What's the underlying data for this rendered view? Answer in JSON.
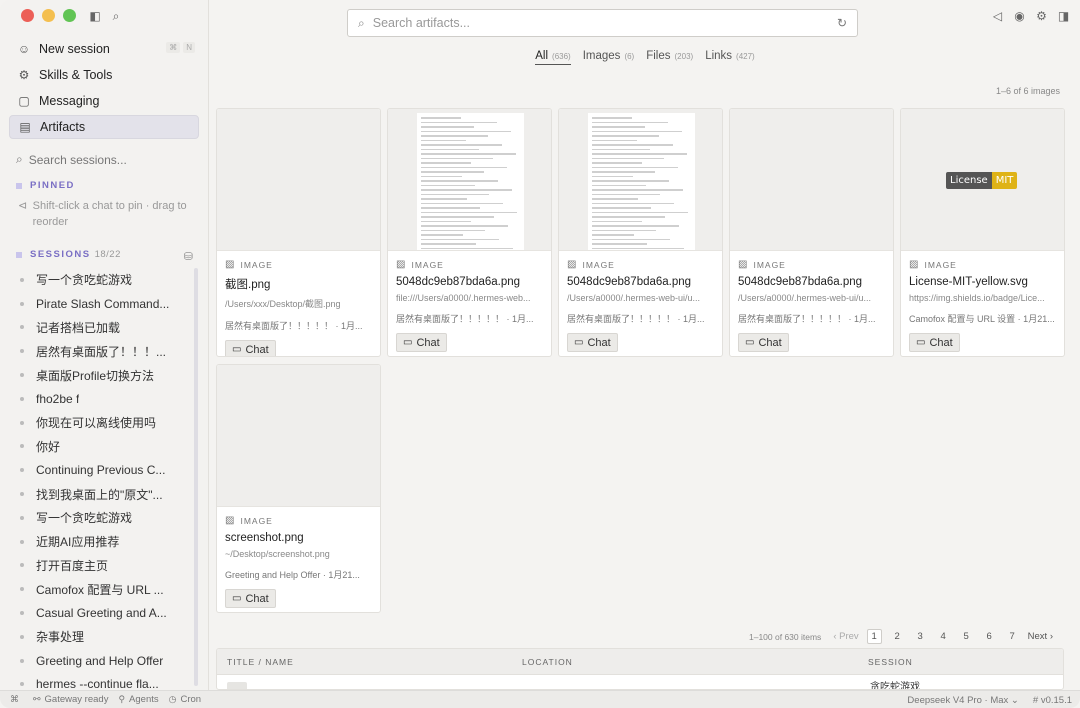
{
  "sidebar": {
    "nav": [
      {
        "label": "New session",
        "icon": "person-icon",
        "glyph": "☺",
        "shortcut": [
          "⌘",
          "N"
        ]
      },
      {
        "label": "Skills & Tools",
        "icon": "tools-icon",
        "glyph": "⚙"
      },
      {
        "label": "Messaging",
        "icon": "chat-bubble-icon",
        "glyph": "▢"
      },
      {
        "label": "Artifacts",
        "icon": "artifacts-icon",
        "glyph": "▤"
      }
    ],
    "search_placeholder": "Search sessions...",
    "pinned_title": "PINNED",
    "pinned_hint": "Shift-click a chat to pin · drag to reorder",
    "sessions_title": "SESSIONS",
    "sessions_count": "18/22",
    "sessions": [
      "写一个贪吃蛇游戏",
      "Pirate Slash Command...",
      "记者搭档已加载",
      "居然有桌面版了！！！...",
      "桌面版Profile切换方法",
      "fho2be f",
      "你现在可以离线使用吗",
      "你好",
      "Continuing Previous C...",
      "找到我桌面上的\"原文\"...",
      "写一个贪吃蛇游戏",
      "近期AI应用推荐",
      "打开百度主页",
      "Camofox 配置与 URL ...",
      "Casual Greeting and A...",
      "杂事处理",
      "Greeting and Help Offer",
      "hermes --continue fla..."
    ]
  },
  "main": {
    "search_placeholder": "Search artifacts...",
    "tabs": [
      {
        "label": "All",
        "count": "(636)"
      },
      {
        "label": "Images",
        "count": "(6)"
      },
      {
        "label": "Files",
        "count": "(203)"
      },
      {
        "label": "Links",
        "count": "(427)"
      }
    ],
    "range_text": "1–6 of 6 images",
    "type_label": "IMAGE",
    "chat_label": "Chat",
    "cards": [
      {
        "name": "截图.png",
        "path": "/Users/xxx/Desktop/截图.png",
        "meta": "居然有桌面版了！！！！！ · 1月...",
        "thumb": "blank"
      },
      {
        "name": "5048dc9eb87bda6a.png",
        "path": "file:///Users/a0000/.hermes-web...",
        "meta": "居然有桌面版了！！！！！ · 1月...",
        "thumb": "doc"
      },
      {
        "name": "5048dc9eb87bda6a.png",
        "path": "/Users/a0000/.hermes-web-ui/u...",
        "meta": "居然有桌面版了！！！！！ · 1月...",
        "thumb": "doc"
      },
      {
        "name": "5048dc9eb87bda6a.png",
        "path": "/Users/a0000/.hermes-web-ui/u...",
        "meta": "居然有桌面版了！！！！！ · 1月...",
        "thumb": "blank"
      },
      {
        "name": "License-MIT-yellow.svg",
        "path": "https://img.shields.io/badge/Lice...",
        "meta": "Camofox 配置与 URL 设置 · 1月21...",
        "thumb": "badge"
      },
      {
        "name": "screenshot.png",
        "path": "~/Desktop/screenshot.png",
        "meta": "Greeting and Help Offer · 1月21...",
        "thumb": "blank"
      }
    ],
    "badge": {
      "left": "License",
      "right": "MIT"
    },
    "pager": {
      "range": "1–100 of 630 items",
      "prev": "‹ Prev",
      "pages": [
        "1",
        "2",
        "3",
        "4",
        "5",
        "6",
        "7"
      ],
      "next": "Next ›"
    },
    "table": {
      "headers": [
        "TITLE / NAME",
        "LOCATION",
        "SESSION"
      ],
      "row_session": "贪吃蛇游戏"
    }
  },
  "status": {
    "gateway": "Gateway ready",
    "agents": "Agents",
    "cron": "Cron",
    "model": "Deepseek V4 Pro · Max",
    "version": "v0.15.1"
  }
}
